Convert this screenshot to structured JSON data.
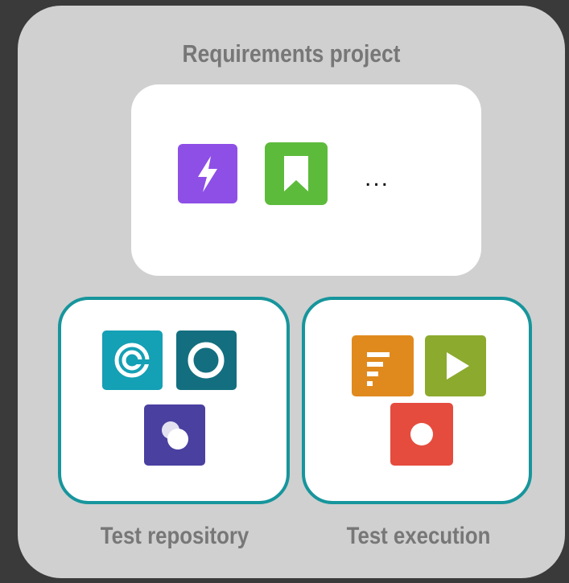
{
  "requirements": {
    "title": "Requirements project",
    "ellipsis": "..."
  },
  "test_repository": {
    "caption": "Test repository"
  },
  "test_execution": {
    "caption": "Test execution"
  },
  "icons": {
    "requirements": [
      "lightning-icon",
      "bookmark-icon"
    ],
    "test_repository": [
      "target-icon",
      "circle-icon",
      "overlapping-circles-icon"
    ],
    "test_execution": [
      "list-icon",
      "play-icon",
      "record-icon"
    ]
  },
  "colors": {
    "background": "#3a3a3a",
    "panel": "#d0d0d0",
    "box_border": "#17959c",
    "label": "#777777",
    "lightning": "#8e4fe6",
    "bookmark": "#5dbb3c",
    "target": "#14a0b5",
    "circle": "#136f80",
    "overlap": "#4a40a0",
    "list": "#e08a1e",
    "play": "#8caa2e",
    "record": "#e54c3e"
  }
}
